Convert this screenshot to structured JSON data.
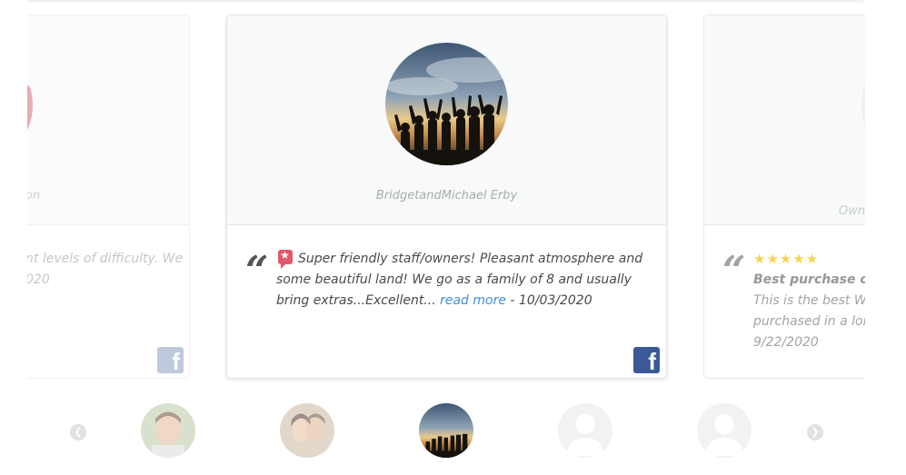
{
  "carousel": {
    "left_card": {
      "name_fragment": "on",
      "text_line1": "nt levels of difficulty. We",
      "text_line2": "020",
      "source_icon": "facebook-icon"
    },
    "center_card": {
      "reviewer_name": "BridgetandMichael Erby",
      "review_text": "Super friendly staff/owners! Pleasant atmosphere and some beautiful land! We go as a family of 8 and usually bring extras...Excellent...",
      "read_more_label": "read more",
      "separator": " - ",
      "date": "10/03/2020",
      "badge_icon": "yelp-star-icon",
      "source_icon": "facebook-icon"
    },
    "right_card": {
      "name_fragment": "Owne",
      "rating": 5,
      "title_fragment": "Best purchase of th",
      "text_line1": "This is the best Word",
      "text_line2": "purchased in a long",
      "date": "9/22/2020"
    }
  },
  "thumbnails": [
    {
      "name": "reviewer-thumb-1",
      "type": "photo-man"
    },
    {
      "name": "reviewer-thumb-2",
      "type": "photo-couple"
    },
    {
      "name": "reviewer-thumb-3",
      "type": "photo-group",
      "active": true
    },
    {
      "name": "reviewer-thumb-4",
      "type": "default-avatar"
    },
    {
      "name": "reviewer-thumb-5",
      "type": "default-avatar"
    }
  ],
  "nav": {
    "prev_icon": "chevron-left-icon",
    "next_icon": "chevron-right-icon"
  },
  "colors": {
    "link": "#3f8ed6",
    "facebook": "#3b5998",
    "star": "#f4d03f",
    "badge": "#e2576a"
  }
}
